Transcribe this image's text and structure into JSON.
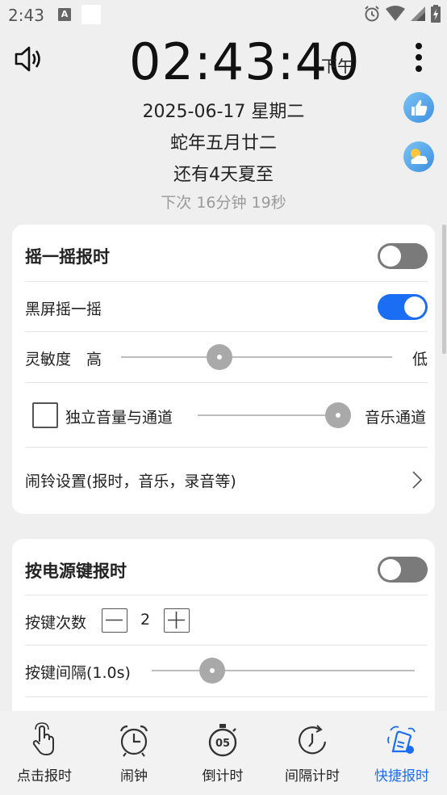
{
  "status_bar": {
    "time": "2:43",
    "notif_icon_letter": "A",
    "icons": [
      "alarm-icon",
      "wifi-icon",
      "signal-icon",
      "battery-icon"
    ]
  },
  "header": {
    "clock": "02:43:40",
    "ampm": "下午",
    "date": "2025-06-17 星期二",
    "lunar": "蛇年五月廿二",
    "solar_term": "还有4天夏至",
    "next_chime": "下次  16分钟 19秒"
  },
  "shake_card": {
    "title": "摇一摇报时",
    "title_toggle": "off",
    "black_screen_label": "黑屏摇一摇",
    "black_screen_toggle": "on",
    "sensitivity_label": "灵敏度",
    "sensitivity_high": "高",
    "sensitivity_low": "低",
    "sensitivity_value": 0.35,
    "independent_volume_label": "独立音量与通道",
    "independent_volume_checked": false,
    "volume_value": 1.0,
    "channel_label": "音乐通道",
    "alarm_settings_link": "闹铃设置(报时，音乐，录音等)"
  },
  "power_card": {
    "title": "按电源键报时",
    "title_toggle": "off",
    "press_count_label": "按键次数",
    "press_count_value": "2",
    "press_interval_label": "按键间隔(1.0s)",
    "press_interval_value": 0.2
  },
  "bottom_nav": [
    {
      "label": "点击报时",
      "icon": "tap-hand-icon",
      "active": false
    },
    {
      "label": "闹钟",
      "icon": "alarm-clock-icon",
      "active": false
    },
    {
      "label": "倒计时",
      "icon": "stopwatch-icon",
      "active": false
    },
    {
      "label": "间隔计时",
      "icon": "interval-timer-icon",
      "active": false
    },
    {
      "label": "快捷报时",
      "icon": "quick-chime-icon",
      "active": true
    }
  ],
  "colors": {
    "accent": "#1b6ef3",
    "toggle_off": "#7a7a7a",
    "background": "#efefef"
  }
}
